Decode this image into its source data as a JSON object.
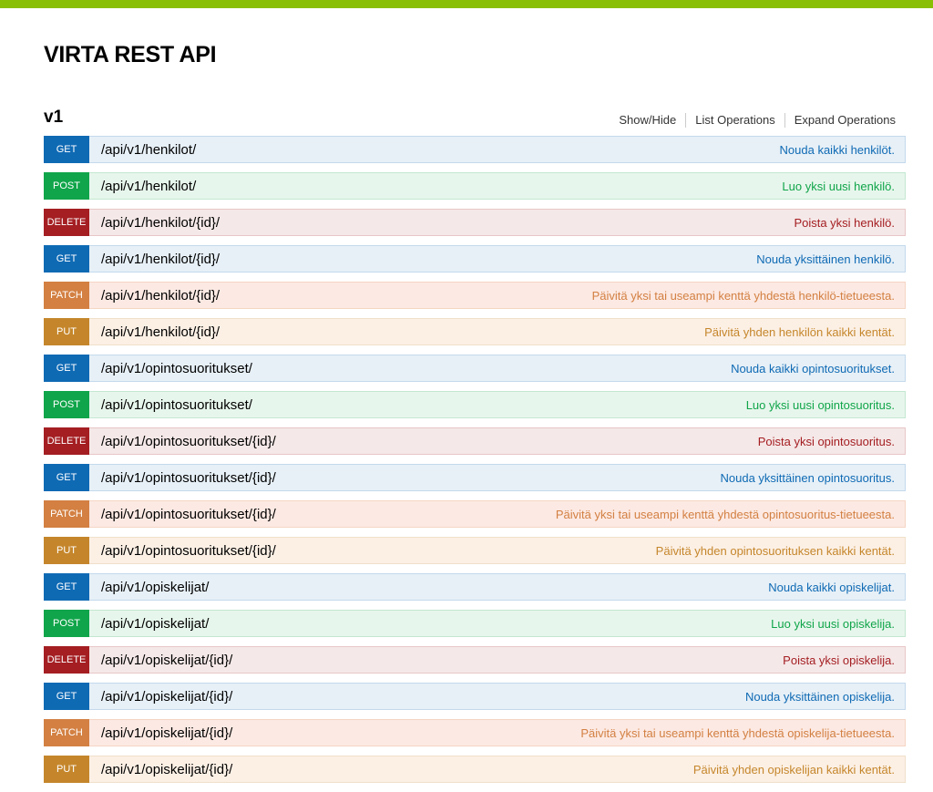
{
  "colors": {
    "topbar": "#89bf04",
    "get": {
      "badge": "#0f6ab4",
      "bg": "#e7f0f7",
      "border": "#c3d9ec",
      "text": "#0f6ab4"
    },
    "post": {
      "badge": "#10a54a",
      "bg": "#e7f6ec",
      "border": "#c3e8d1",
      "text": "#10a54a"
    },
    "delete": {
      "badge": "#a41e22",
      "bg": "#f5e8e8",
      "border": "#e8c6c7",
      "text": "#a41e22"
    },
    "patch": {
      "badge": "#d38042",
      "bg": "#fce9e3",
      "border": "#f5d5c3",
      "text": "#d38042"
    },
    "put": {
      "badge": "#c5862b",
      "bg": "#fcf0e5",
      "border": "#f0e0ca",
      "text": "#c5862b"
    }
  },
  "header": {
    "title": "VIRTA REST API"
  },
  "resource": {
    "name": "v1",
    "links": {
      "show_hide": "Show/Hide",
      "list_operations": "List Operations",
      "expand_operations": "Expand Operations"
    }
  },
  "operations": [
    {
      "method": "GET",
      "path": "/api/v1/henkilot/",
      "summary": "Nouda kaikki henkilöt."
    },
    {
      "method": "POST",
      "path": "/api/v1/henkilot/",
      "summary": "Luo yksi uusi henkilö."
    },
    {
      "method": "DELETE",
      "path": "/api/v1/henkilot/{id}/",
      "summary": "Poista yksi henkilö."
    },
    {
      "method": "GET",
      "path": "/api/v1/henkilot/{id}/",
      "summary": "Nouda yksittäinen henkilö."
    },
    {
      "method": "PATCH",
      "path": "/api/v1/henkilot/{id}/",
      "summary": "Päivitä yksi tai useampi kenttä yhdestä henkilö-tietueesta."
    },
    {
      "method": "PUT",
      "path": "/api/v1/henkilot/{id}/",
      "summary": "Päivitä yhden henkilön kaikki kentät."
    },
    {
      "method": "GET",
      "path": "/api/v1/opintosuoritukset/",
      "summary": "Nouda kaikki opintosuoritukset."
    },
    {
      "method": "POST",
      "path": "/api/v1/opintosuoritukset/",
      "summary": "Luo yksi uusi opintosuoritus."
    },
    {
      "method": "DELETE",
      "path": "/api/v1/opintosuoritukset/{id}/",
      "summary": "Poista yksi opintosuoritus."
    },
    {
      "method": "GET",
      "path": "/api/v1/opintosuoritukset/{id}/",
      "summary": "Nouda yksittäinen opintosuoritus."
    },
    {
      "method": "PATCH",
      "path": "/api/v1/opintosuoritukset/{id}/",
      "summary": "Päivitä yksi tai useampi kenttä yhdestä opintosuoritus-tietueesta."
    },
    {
      "method": "PUT",
      "path": "/api/v1/opintosuoritukset/{id}/",
      "summary": "Päivitä yhden opintosuorituksen kaikki kentät."
    },
    {
      "method": "GET",
      "path": "/api/v1/opiskelijat/",
      "summary": "Nouda kaikki opiskelijat."
    },
    {
      "method": "POST",
      "path": "/api/v1/opiskelijat/",
      "summary": "Luo yksi uusi opiskelija."
    },
    {
      "method": "DELETE",
      "path": "/api/v1/opiskelijat/{id}/",
      "summary": "Poista yksi opiskelija."
    },
    {
      "method": "GET",
      "path": "/api/v1/opiskelijat/{id}/",
      "summary": "Nouda yksittäinen opiskelija."
    },
    {
      "method": "PATCH",
      "path": "/api/v1/opiskelijat/{id}/",
      "summary": "Päivitä yksi tai useampi kenttä yhdestä opiskelija-tietueesta."
    },
    {
      "method": "PUT",
      "path": "/api/v1/opiskelijat/{id}/",
      "summary": "Päivitä yhden opiskelijan kaikki kentät."
    }
  ]
}
